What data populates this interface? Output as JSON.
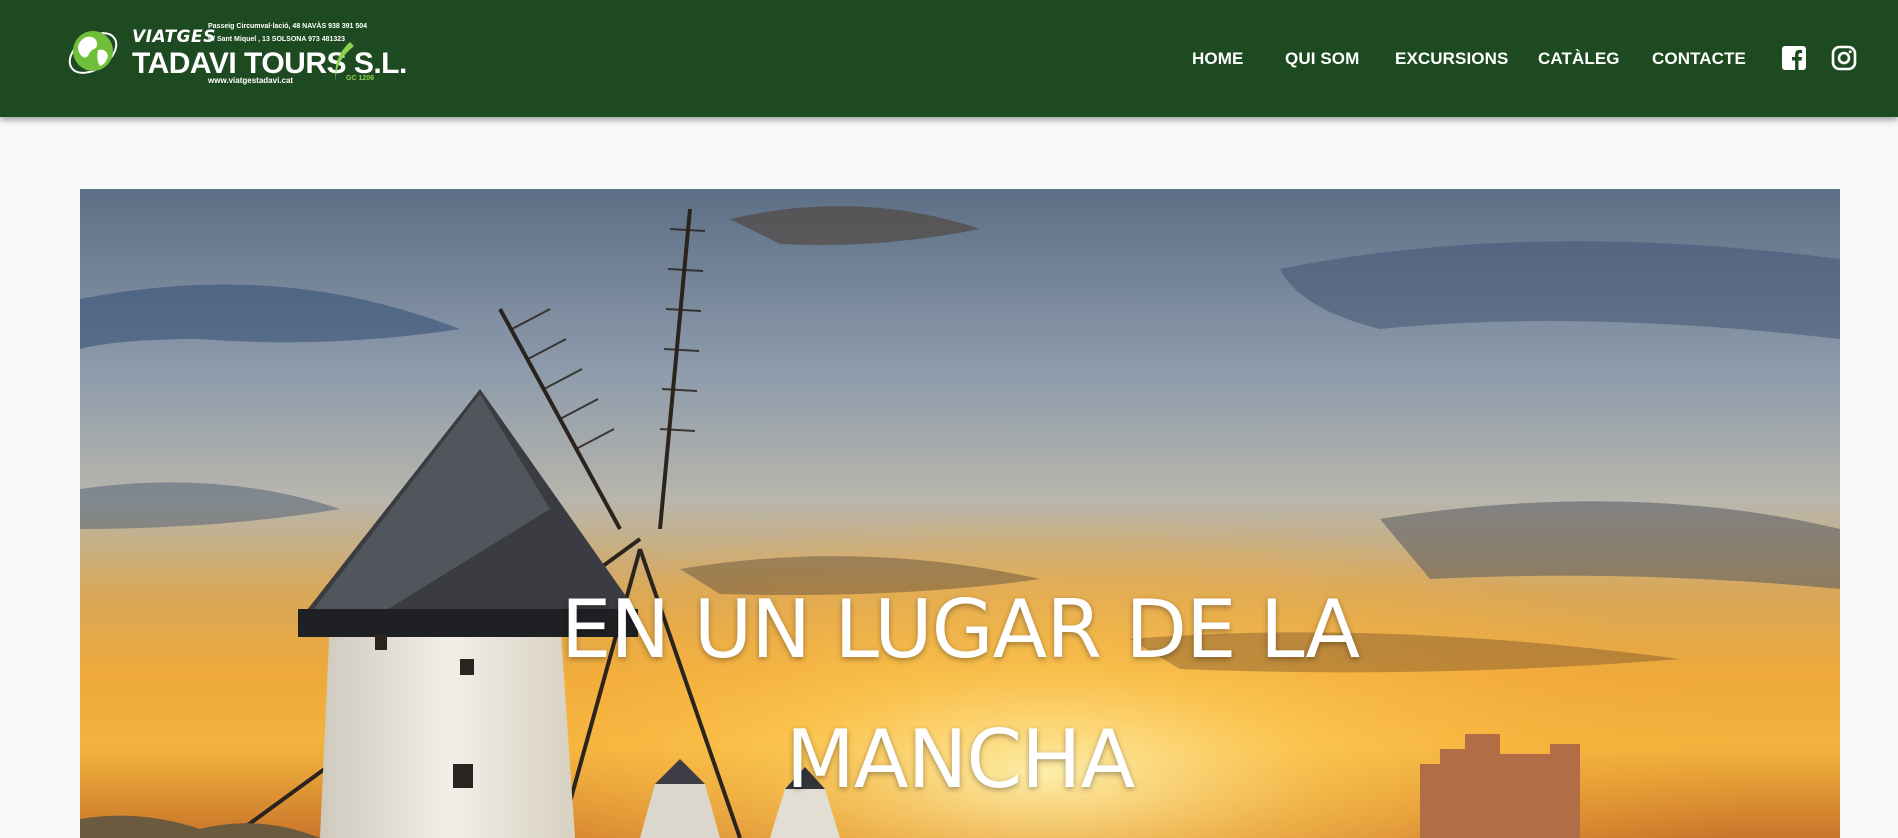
{
  "logo": {
    "line1": "VIATGES",
    "name": "TADAVI TOURS S.L.",
    "address": [
      "Passeig Circumval·lació, 48 NAVÀS 938 391 504",
      "C/ Sant Miquel , 13  SOLSONA  973 481323"
    ],
    "website": "www.viatgestadavi.cat",
    "license": "GC 1206"
  },
  "nav": {
    "items": [
      {
        "label": "HOME"
      },
      {
        "label": "QUI SOM"
      },
      {
        "label": "EXCURSIONS"
      },
      {
        "label": "CATÀLEG"
      },
      {
        "label": "CONTACTE"
      }
    ]
  },
  "social": {
    "facebook_icon": "facebook-icon",
    "instagram_icon": "instagram-icon"
  },
  "hero": {
    "title": "EN UN LUGAR DE LA MANCHA"
  },
  "colors": {
    "header_bg": "#1e4a22",
    "page_bg": "#f8f8f8",
    "accent_green": "#8fd14f"
  }
}
